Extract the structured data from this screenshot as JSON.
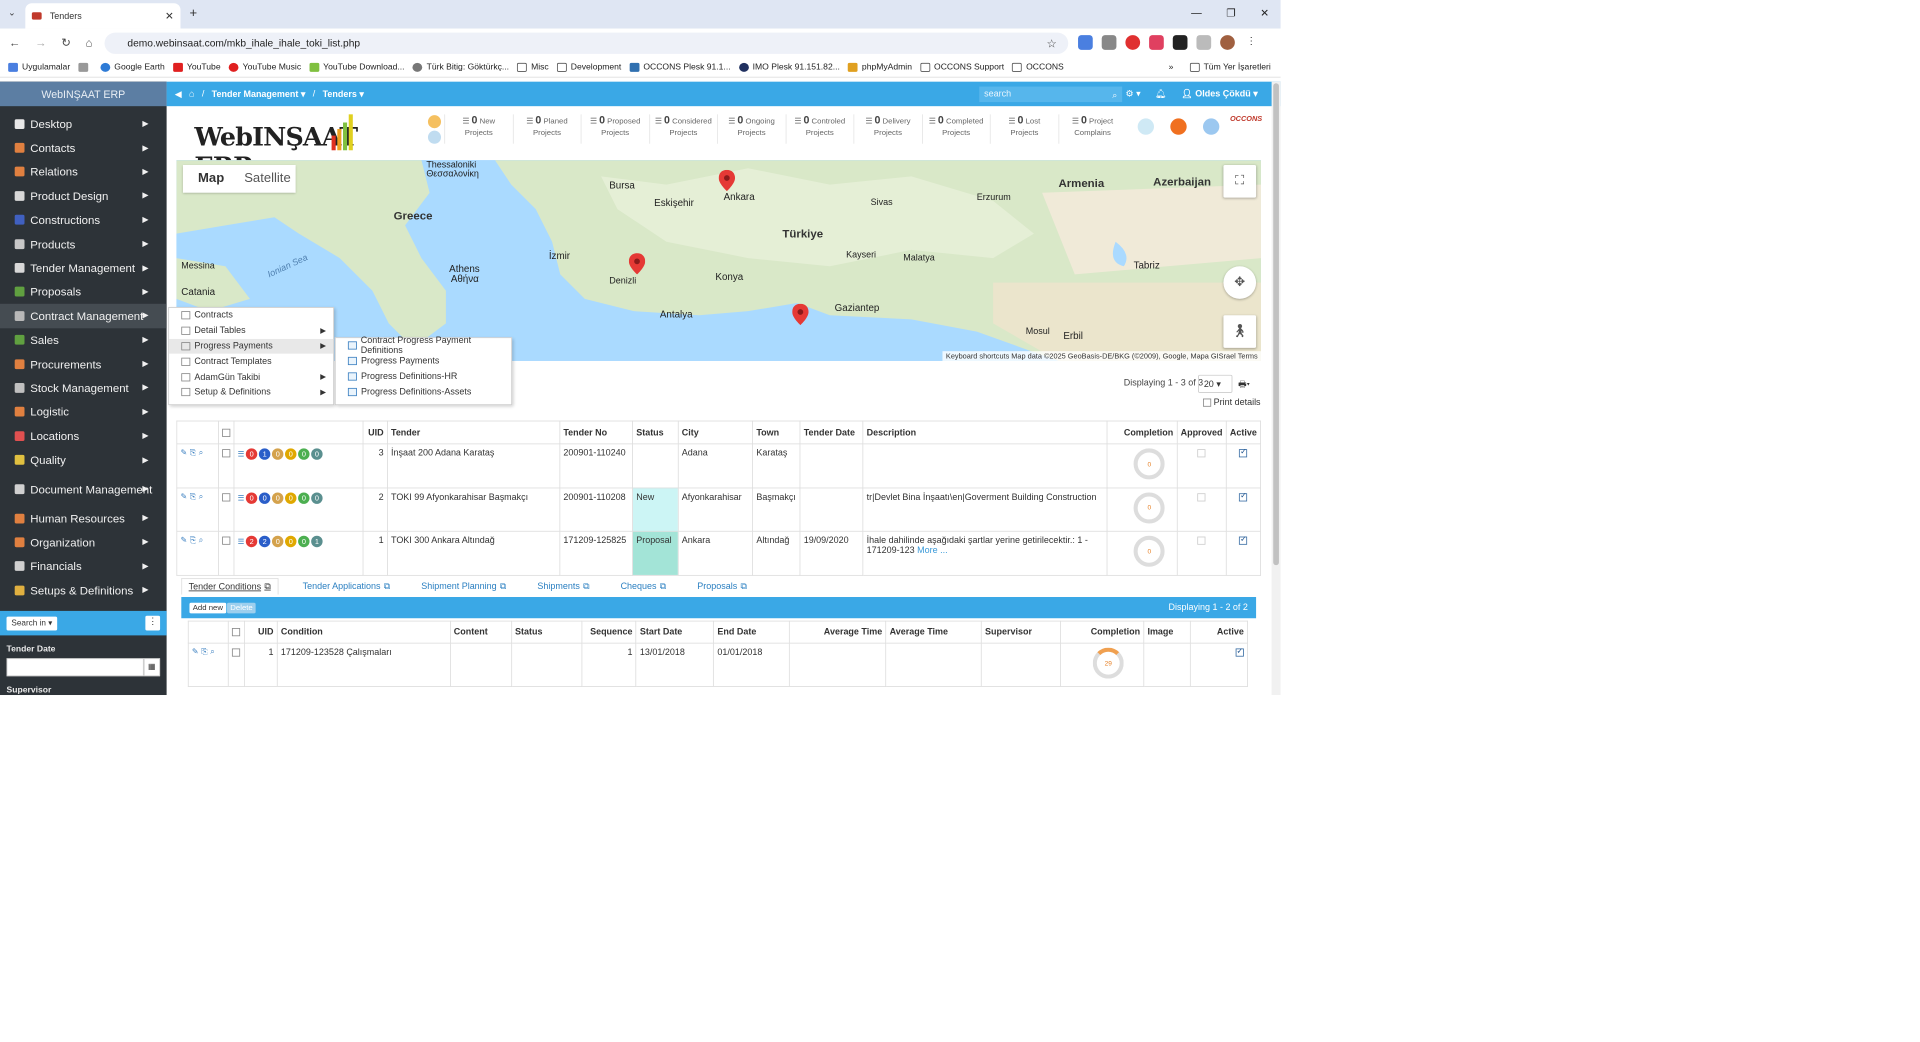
{
  "browser": {
    "tab_title": "Tenders",
    "url": "demo.webinsaat.com/mkb_ihale_ihale_toki_list.php",
    "bookmarks": [
      "Uygulamalar",
      "Google Earth",
      "YouTube",
      "YouTube Music",
      "YouTube Download...",
      "Türk Bitig: Göktürkç...",
      "Misc",
      "Development",
      "OCCONS Plesk 91.1...",
      "IMO Plesk 91.151.82...",
      "phpMyAdmin",
      "OCCONS Support",
      "OCCONS"
    ],
    "other_bookmarks": "Tüm Yer İşaretleri"
  },
  "sidebar": {
    "brand": "WebINŞAAT ERP",
    "items": [
      {
        "label": "Desktop",
        "color": "#e8e8e8"
      },
      {
        "label": "Contacts",
        "color": "#e08040"
      },
      {
        "label": "Relations",
        "color": "#e08040"
      },
      {
        "label": "Product Design",
        "color": "#d8d8d8"
      },
      {
        "label": "Constructions",
        "color": "#4060c0"
      },
      {
        "label": "Products",
        "color": "#c8c8c8"
      },
      {
        "label": "Tender Management",
        "color": "#d8d8d8"
      },
      {
        "label": "Proposals",
        "color": "#60a040"
      },
      {
        "label": "Contract Management",
        "color": "#b8b8b8"
      },
      {
        "label": "Sales",
        "color": "#60a040"
      },
      {
        "label": "Procurements",
        "color": "#e08040"
      },
      {
        "label": "Stock Management",
        "color": "#c0c0c0"
      },
      {
        "label": "Logistic",
        "color": "#e08040"
      },
      {
        "label": "Locations",
        "color": "#e05050"
      },
      {
        "label": "Quality",
        "color": "#e0c040"
      },
      {
        "label": "Document Management",
        "color": "#d0d0d0"
      },
      {
        "label": "Human Resources",
        "color": "#e08040"
      },
      {
        "label": "Organization",
        "color": "#e08040"
      },
      {
        "label": "Financials",
        "color": "#d0d0d0"
      },
      {
        "label": "Setups & Definitions",
        "color": "#e0b040"
      }
    ],
    "search_in": "Search in",
    "filter_tender_date": "Tender Date",
    "filter_supervisor": "Supervisor"
  },
  "topbar": {
    "crumb1": "Tender Management",
    "crumb2": "Tenders",
    "search_placeholder": "search",
    "user": "Oldes Çökdü"
  },
  "stats": [
    {
      "n": "0",
      "l1": "New",
      "l2": "Projects"
    },
    {
      "n": "0",
      "l1": "Planed",
      "l2": "Projects"
    },
    {
      "n": "0",
      "l1": "Proposed",
      "l2": "Projects"
    },
    {
      "n": "0",
      "l1": "Considered",
      "l2": "Projects"
    },
    {
      "n": "0",
      "l1": "Ongoing",
      "l2": "Projects"
    },
    {
      "n": "0",
      "l1": "Controled",
      "l2": "Projects"
    },
    {
      "n": "0",
      "l1": "Delivery",
      "l2": "Projects"
    },
    {
      "n": "0",
      "l1": "Completed",
      "l2": "Projects"
    },
    {
      "n": "0",
      "l1": "Lost",
      "l2": "Projects"
    },
    {
      "n": "0",
      "l1": "Project",
      "l2": "Complains"
    }
  ],
  "map": {
    "tab_map": "Map",
    "tab_satellite": "Satellite",
    "labels": [
      "Thessaloniki",
      "Θεσσαλονίκη",
      "Greece",
      "Türkiye",
      "Ankara",
      "Bursa",
      "Eskişehir",
      "Konya",
      "İzmir",
      "Denizli",
      "Antalya",
      "Athens",
      "Αθήνα",
      "Armenia",
      "Azerbaijan",
      "Gaziantep",
      "Messina",
      "Catania",
      "Ionian Sea",
      "Erzurum",
      "Sivas",
      "Kayseri",
      "Malatya",
      "Tabriz",
      "Erbil",
      "Mosul"
    ],
    "attribution": "Keyboard shortcuts   Map data ©2025 GeoBasis-DE/BKG (©2009), Google, Mapa GISrael   Terms"
  },
  "contract_menu": {
    "items": [
      "Contracts",
      "Detail Tables",
      "Progress Payments",
      "Contract Templates",
      "AdamGün Takibi",
      "Setup & Definitions"
    ],
    "submenu": [
      "Contract Progress Payment Definitions",
      "Progress Payments",
      "Progress Definitions-HR",
      "Progress Definitions-Assets"
    ]
  },
  "list": {
    "displaying": "Displaying 1 - 3 of 3",
    "page_size": "20",
    "print_details": "Print details",
    "columns": [
      "UID",
      "Tender",
      "Tender No",
      "Status",
      "City",
      "Town",
      "Tender Date",
      "Description",
      "Completion",
      "Approved",
      "Active"
    ],
    "rows": [
      {
        "uid": "3",
        "tender": "İnşaat 200 Adana Karataş",
        "no": "200901-110240",
        "status": "",
        "city": "Adana",
        "town": "Karataş",
        "date": "",
        "desc": "",
        "more": "",
        "badges": [
          "0",
          "1",
          "0",
          "0",
          "0",
          "0"
        ],
        "completion": "0"
      },
      {
        "uid": "2",
        "tender": "TOKI 99 Afyonkarahisar Başmakçı",
        "no": "200901-110208",
        "status": "New",
        "city": "Afyonkarahisar",
        "town": "Başmakçı",
        "date": "",
        "desc": "tr|Devlet Bina İnşaatı\\en|Goverment Building Construction",
        "more": "",
        "badges": [
          "0",
          "0",
          "0",
          "0",
          "0",
          "0"
        ],
        "completion": "0"
      },
      {
        "uid": "1",
        "tender": "TOKI 300 Ankara Altındağ",
        "no": "171209-125825",
        "status": "Proposal",
        "city": "Ankara",
        "town": "Altındağ",
        "date": "19/09/2020",
        "desc": "İhale dahilinde aşağıdaki şartlar yerine getirilecektir.: 1 - 171209-123",
        "more": "More ...",
        "badges": [
          "2",
          "2",
          "0",
          "0",
          "0",
          "1"
        ],
        "completion": "0"
      }
    ]
  },
  "subtabs": [
    "Tender Conditions",
    "Tender Applications",
    "Shipment Planning",
    "Shipments",
    "Cheques",
    "Proposals"
  ],
  "subgrid": {
    "add_new": "Add new",
    "delete": "Delete",
    "displaying": "Displaying 1 - 2 of 2",
    "columns": [
      "UID",
      "Condition",
      "Content",
      "Status",
      "Sequence",
      "Start Date",
      "End Date",
      "Average Time",
      "Average Time",
      "Supervisor",
      "Completion",
      "Image",
      "Active"
    ],
    "rows": [
      {
        "uid": "1",
        "condition": "171209-123528 Çalışmaları",
        "seq": "1",
        "start": "13/01/2018",
        "end": "01/01/2018",
        "completion": "29"
      }
    ]
  }
}
